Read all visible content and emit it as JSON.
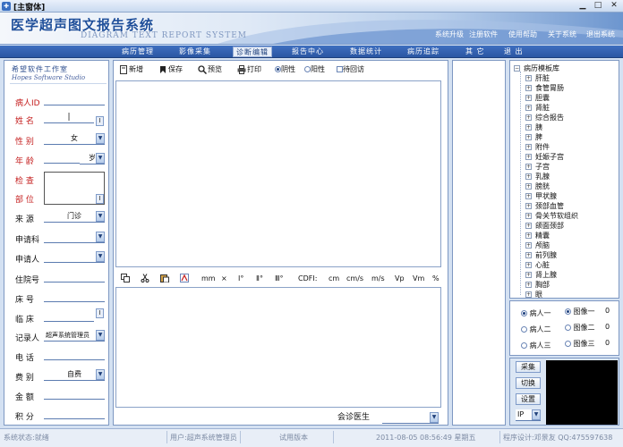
{
  "window": {
    "title": "[主窗体]",
    "min": "▁",
    "max": "□",
    "close": "✕"
  },
  "banner": {
    "title_cn": "医学超声图文报告系统",
    "title_en": "DIAGRAM   TEXT   REPORT   SYSTEM",
    "links": [
      "系统升级",
      "注册软件",
      "使用帮助",
      "关于系统",
      "退出系统"
    ]
  },
  "menu": {
    "items": [
      "病历管理",
      "影像采集",
      "诊断编辑",
      "报告中心",
      "数据统计",
      "病历追踪",
      "其 它",
      "退 出"
    ],
    "active_index": 2
  },
  "company": {
    "name_cn": "希望软件工作室",
    "name_en": "Hopes Software Studio"
  },
  "patient_form": {
    "id_label": "病人ID",
    "name_label": "姓 名",
    "name_value": "|",
    "gender_label": "性 别",
    "gender_value": "女",
    "age_label": "年 龄",
    "age_unit": "岁",
    "exam_label": "检 查",
    "part_label": "部 位",
    "source_label": "来 源",
    "source_value": "门诊",
    "apply_dept_label": "申请科",
    "applicant_label": "申请人",
    "inpatient_label": "住院号",
    "bed_label": "床 号",
    "clinical_label": "临 床",
    "recorder_label": "记录人",
    "recorder_value": "超声系统管理员",
    "phone_label": "电 话",
    "fee_label": "费 别",
    "fee_value": "自费",
    "amount_label": "金 额",
    "points_label": "积 分",
    "ellipsis": "I"
  },
  "editor_toolbar": {
    "new": "新增",
    "save": "保存",
    "preview": "预览",
    "print": "打印",
    "negative": "阴性",
    "positive": "阳性",
    "revisit": "待回访"
  },
  "symbol_toolbar": {
    "items": [
      "mm",
      "×",
      "Ⅰ°",
      "Ⅱ°",
      "Ⅲ°",
      "CDFI:",
      "cm",
      "cm/s",
      "m/s",
      "Vp",
      "Vm",
      "%"
    ]
  },
  "doctor": {
    "label": "会诊医生",
    "value": ""
  },
  "template_tree": {
    "root": "病历模板库",
    "items": [
      "肝脏",
      "食管胃肠",
      "胆囊",
      "肾脏",
      "综合报告",
      "胰",
      "脾",
      "附件",
      "妊娠子宫",
      "子宫",
      "乳腺",
      "膀胱",
      "甲状腺",
      "颈部血管",
      "骨关节软组织",
      "颌面颈部",
      "精囊",
      "颅脑",
      "前列腺",
      "心脏",
      "肾上腺",
      "胸部",
      "眼"
    ]
  },
  "image_panel": {
    "patients": [
      "病人一",
      "病人二",
      "病人三"
    ],
    "images": [
      "图像一",
      "图像二",
      "图像三"
    ],
    "counts": [
      "0",
      "0",
      "0"
    ]
  },
  "capture": {
    "collect": "采集",
    "switch": "切换",
    "settings": "设置",
    "mode": "IP"
  },
  "status": {
    "state": "系统状态:就绪",
    "user": "用户:超声系统管理员",
    "version": "试用版本",
    "datetime": "2011-08-05  08:56:49  星期五",
    "credits": "程序设计:邓景友  QQ:475597638"
  },
  "colors": {
    "menu_bg": "#2f5fae",
    "required_label": "#c41c1c",
    "preview_bg": "#000000"
  }
}
